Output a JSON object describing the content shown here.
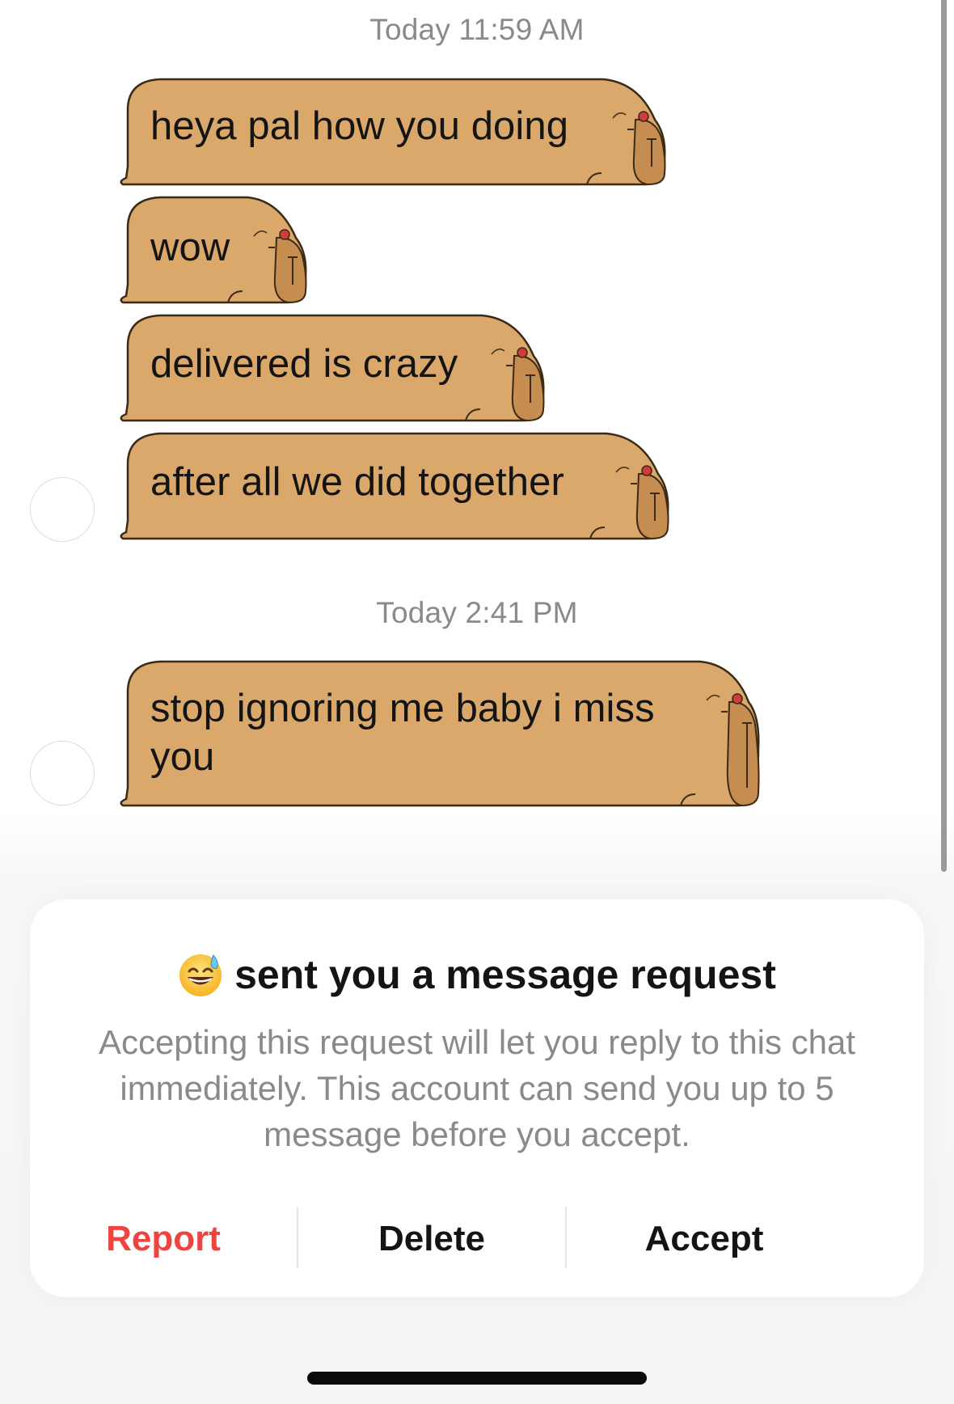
{
  "chat": {
    "timestamp_1": "Today 11:59 AM",
    "timestamp_2": "Today 2:41 PM",
    "messages": [
      {
        "text": "heya pal how you doing"
      },
      {
        "text": "wow"
      },
      {
        "text": "delivered is crazy"
      },
      {
        "text": "after all we did together"
      },
      {
        "line1": "stop ignoring me baby i miss",
        "line2": "you"
      }
    ],
    "bubble_style": {
      "fill": "#d9a86a",
      "stroke": "#3a2a17",
      "head_fill": "#c58d4f",
      "accent": "#d23b3b",
      "icon": "capybara-sticker-icon"
    }
  },
  "request_card": {
    "emoji": "😅",
    "emoji_icon": "grinning-sweat-emoji-icon",
    "title": "sent you a message request",
    "description": "Accepting this request will let you reply to this chat immediately. This account can send you up to 5 message before you accept.",
    "actions": {
      "report": "Report",
      "delete": "Delete",
      "accept": "Accept"
    },
    "report_color": "#f0433f"
  }
}
